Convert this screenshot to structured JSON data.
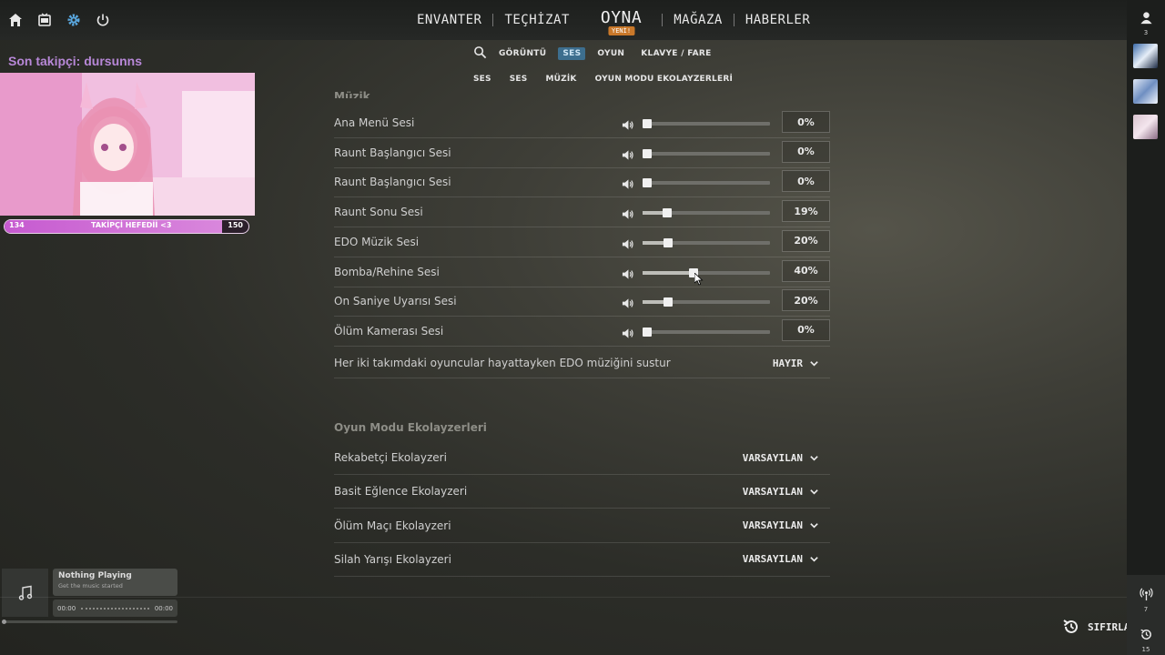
{
  "top_nav": {
    "items": [
      "ENVANTER",
      "TEÇHİZAT",
      "OYNA",
      "MAĞAZA",
      "HABERLER"
    ],
    "play_badge": "YENİ!"
  },
  "tabs": {
    "primary": [
      "GÖRÜNTÜ",
      "SES",
      "OYUN",
      "KLAVYE / FARE"
    ],
    "active_primary": "SES",
    "secondary": [
      "SES",
      "SES",
      "MÜZİK",
      "OYUN MODU EKOLAYZERLERİ"
    ]
  },
  "music_section": {
    "title": "Müzik",
    "sliders": [
      {
        "label": "Ana Menü Sesi",
        "value": "0%",
        "percent": 0
      },
      {
        "label": "Raunt Başlangıcı Sesi",
        "value": "0%",
        "percent": 0
      },
      {
        "label": "Raunt Başlangıcı Sesi",
        "value": "0%",
        "percent": 0
      },
      {
        "label": "Raunt Sonu Sesi",
        "value": "19%",
        "percent": 19
      },
      {
        "label": "EDO Müzik Sesi",
        "value": "20%",
        "percent": 20
      },
      {
        "label": "Bomba/Rehine Sesi",
        "value": "40%",
        "percent": 40
      },
      {
        "label": "On Saniye Uyarısı Sesi",
        "value": "20%",
        "percent": 20
      },
      {
        "label": "Ölüm Kamerası Sesi",
        "value": "0%",
        "percent": 0
      }
    ],
    "mute_toggle": {
      "label": "Her iki takımdaki oyuncular hayattayken EDO müziğini sustur",
      "value": "HAYIR"
    }
  },
  "equalizer_section": {
    "title": "Oyun Modu Ekolayzerleri",
    "rows": [
      {
        "label": "Rekabetçi Ekolayzeri",
        "value": "VARSAYILAN"
      },
      {
        "label": "Basit Eğlence Ekolayzeri",
        "value": "VARSAYILAN"
      },
      {
        "label": "Ölüm Maçı Ekolayzeri",
        "value": "VARSAYILAN"
      },
      {
        "label": "Silah Yarışı Ekolayzeri",
        "value": "VARSAYILAN"
      }
    ]
  },
  "stream_overlay": {
    "last_follower": "Son takipçi: dursunns",
    "goal": {
      "current": "134",
      "label": "TAKİPÇİ HEFEDİİ <3",
      "target": "150",
      "progress": 0.893
    }
  },
  "music_widget": {
    "title": "Nothing Playing",
    "subtitle": "Get the music started",
    "time_start": "00:00",
    "time_end": "00:00"
  },
  "sidebar": {
    "friends_count": "3",
    "notifications_count": "7",
    "history_count": "15"
  },
  "reset_label": "SIFIRLA",
  "colors": {
    "accent_tab": "#3d6e8e",
    "badge": "#c9782a",
    "follower_text": "#b888d8",
    "goal_fill": "#c65ad0"
  }
}
